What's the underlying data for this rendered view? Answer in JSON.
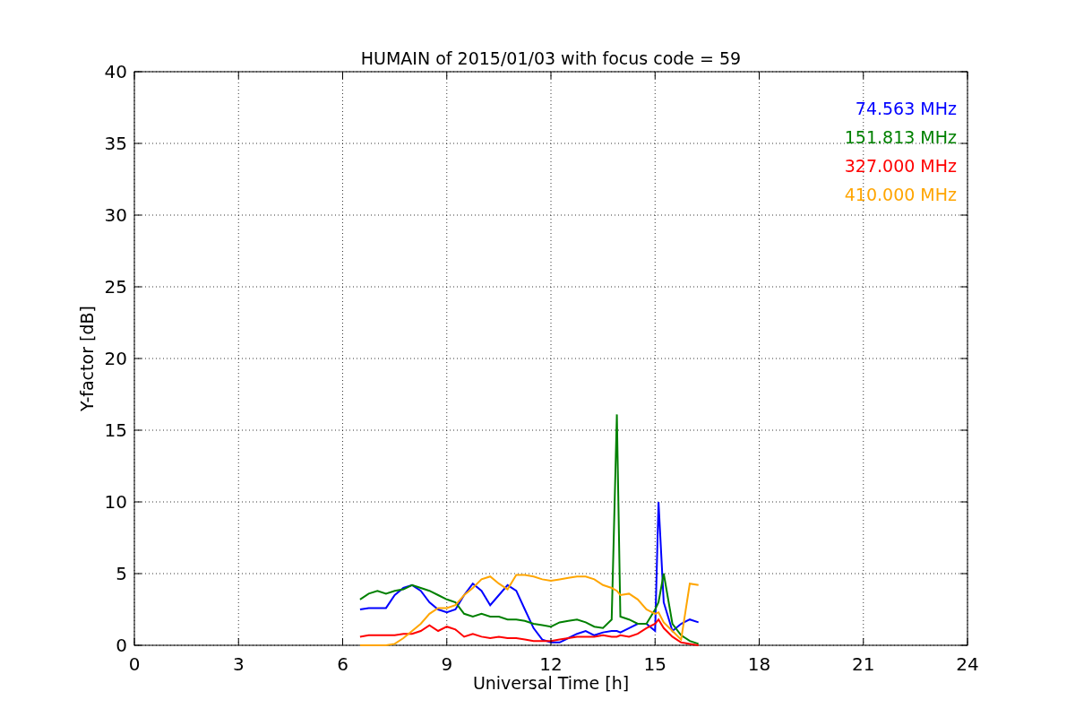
{
  "chart_data": {
    "type": "line",
    "title": "HUMAIN of 2015/01/03 with focus code = 59",
    "xlabel": "Universal Time [h]",
    "ylabel": "Y-factor [dB]",
    "x": [
      6.5,
      6.75,
      7,
      7.25,
      7.5,
      7.75,
      8,
      8.25,
      8.5,
      8.75,
      9,
      9.25,
      9.5,
      9.75,
      10,
      10.25,
      10.5,
      10.75,
      11,
      11.25,
      11.5,
      11.75,
      12,
      12.25,
      12.5,
      12.75,
      13,
      13.25,
      13.5,
      13.75,
      13.9,
      14,
      14.25,
      14.5,
      14.75,
      15,
      15.1,
      15.25,
      15.5,
      15.75,
      16,
      16.25
    ],
    "series": [
      {
        "name": "74.563 MHz",
        "color": "#0000ff",
        "values": [
          2.5,
          2.6,
          2.6,
          2.6,
          3.5,
          4.0,
          4.2,
          3.8,
          3.0,
          2.5,
          2.3,
          2.5,
          3.5,
          4.3,
          3.8,
          2.8,
          3.5,
          4.2,
          3.8,
          2.5,
          1.2,
          0.4,
          0.2,
          0.2,
          0.5,
          0.8,
          1.0,
          0.7,
          0.9,
          1.0,
          1.0,
          0.9,
          1.2,
          1.5,
          1.5,
          1.0,
          10.0,
          3.0,
          1.0,
          1.5,
          1.8,
          1.6
        ]
      },
      {
        "name": "151.813 MHz",
        "color": "#008000",
        "values": [
          3.2,
          3.6,
          3.8,
          3.6,
          3.8,
          3.9,
          4.2,
          4.0,
          3.8,
          3.5,
          3.2,
          3.0,
          2.2,
          2.0,
          2.2,
          2.0,
          2.0,
          1.8,
          1.8,
          1.7,
          1.5,
          1.4,
          1.3,
          1.6,
          1.7,
          1.8,
          1.6,
          1.3,
          1.2,
          1.8,
          16.1,
          2.0,
          1.8,
          1.5,
          1.5,
          2.5,
          3.0,
          5.0,
          1.5,
          0.7,
          0.3,
          0.1
        ]
      },
      {
        "name": "327.000 MHz",
        "color": "#ff0000",
        "values": [
          0.6,
          0.7,
          0.7,
          0.7,
          0.7,
          0.8,
          0.8,
          1.0,
          1.4,
          1.0,
          1.3,
          1.1,
          0.6,
          0.8,
          0.6,
          0.5,
          0.6,
          0.5,
          0.5,
          0.4,
          0.3,
          0.3,
          0.3,
          0.4,
          0.5,
          0.6,
          0.6,
          0.6,
          0.7,
          0.6,
          0.6,
          0.7,
          0.6,
          0.8,
          1.2,
          1.5,
          1.8,
          1.2,
          0.6,
          0.2,
          0.1,
          0.0
        ]
      },
      {
        "name": "410.000 MHz",
        "color": "#ffa500",
        "values": [
          0.0,
          0.0,
          0.0,
          0.0,
          0.1,
          0.5,
          1.0,
          1.5,
          2.2,
          2.6,
          2.6,
          2.8,
          3.5,
          4.0,
          4.6,
          4.8,
          4.3,
          3.9,
          4.9,
          4.9,
          4.8,
          4.6,
          4.5,
          4.6,
          4.7,
          4.8,
          4.8,
          4.6,
          4.2,
          4.0,
          3.8,
          3.5,
          3.6,
          3.2,
          2.5,
          2.2,
          2.3,
          1.6,
          1.0,
          0.4,
          4.3,
          4.2
        ]
      }
    ],
    "grid": true,
    "xlim": [
      0,
      24
    ],
    "ylim": [
      0,
      40
    ],
    "xticks": [
      0,
      3,
      6,
      9,
      12,
      15,
      18,
      21,
      24
    ],
    "yticks": [
      0,
      5,
      10,
      15,
      20,
      25,
      30,
      35,
      40
    ]
  }
}
